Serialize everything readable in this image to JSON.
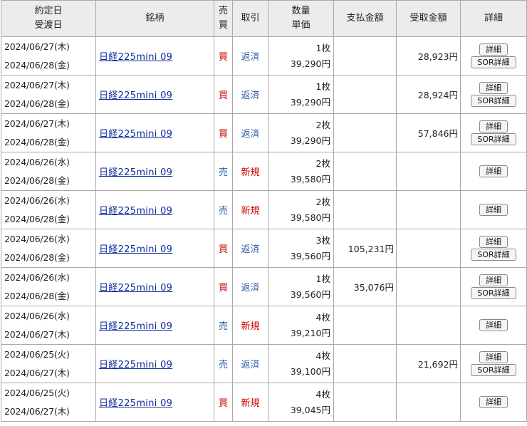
{
  "headers": {
    "date_top": "約定日",
    "date_bottom": "受渡日",
    "name": "銘柄",
    "side_top": "売",
    "side_bottom": "買",
    "trade": "取引",
    "qty_top": "数量",
    "qty_bottom": "単価",
    "pay": "支払金額",
    "receive": "受取金額",
    "detail": "詳細"
  },
  "rows": [
    {
      "trade_date": "2024/06/27(木)",
      "settle_date": "2024/06/28(金)",
      "name": "日経225mini 09",
      "side": "買",
      "trade": "返済",
      "qty": "1枚",
      "price": "39,290円",
      "pay": "",
      "receive": "28,923円",
      "detail": "詳細",
      "sor": "SOR詳細"
    },
    {
      "trade_date": "2024/06/27(木)",
      "settle_date": "2024/06/28(金)",
      "name": "日経225mini 09",
      "side": "買",
      "trade": "返済",
      "qty": "1枚",
      "price": "39,290円",
      "pay": "",
      "receive": "28,924円",
      "detail": "詳細",
      "sor": "SOR詳細"
    },
    {
      "trade_date": "2024/06/27(木)",
      "settle_date": "2024/06/28(金)",
      "name": "日経225mini 09",
      "side": "買",
      "trade": "返済",
      "qty": "2枚",
      "price": "39,290円",
      "pay": "",
      "receive": "57,846円",
      "detail": "詳細",
      "sor": "SOR詳細"
    },
    {
      "trade_date": "2024/06/26(水)",
      "settle_date": "2024/06/28(金)",
      "name": "日経225mini 09",
      "side": "売",
      "trade": "新規",
      "qty": "2枚",
      "price": "39,580円",
      "pay": "",
      "receive": "",
      "detail": "詳細",
      "sor": ""
    },
    {
      "trade_date": "2024/06/26(水)",
      "settle_date": "2024/06/28(金)",
      "name": "日経225mini 09",
      "side": "売",
      "trade": "新規",
      "qty": "2枚",
      "price": "39,580円",
      "pay": "",
      "receive": "",
      "detail": "詳細",
      "sor": ""
    },
    {
      "trade_date": "2024/06/26(水)",
      "settle_date": "2024/06/28(金)",
      "name": "日経225mini 09",
      "side": "買",
      "trade": "返済",
      "qty": "3枚",
      "price": "39,560円",
      "pay": "105,231円",
      "receive": "",
      "detail": "詳細",
      "sor": "SOR詳細"
    },
    {
      "trade_date": "2024/06/26(水)",
      "settle_date": "2024/06/28(金)",
      "name": "日経225mini 09",
      "side": "買",
      "trade": "返済",
      "qty": "1枚",
      "price": "39,560円",
      "pay": "35,076円",
      "receive": "",
      "detail": "詳細",
      "sor": "SOR詳細"
    },
    {
      "trade_date": "2024/06/26(水)",
      "settle_date": "2024/06/27(木)",
      "name": "日経225mini 09",
      "side": "売",
      "trade": "新規",
      "qty": "4枚",
      "price": "39,210円",
      "pay": "",
      "receive": "",
      "detail": "詳細",
      "sor": ""
    },
    {
      "trade_date": "2024/06/25(火)",
      "settle_date": "2024/06/27(木)",
      "name": "日経225mini 09",
      "side": "売",
      "trade": "返済",
      "qty": "4枚",
      "price": "39,100円",
      "pay": "",
      "receive": "21,692円",
      "detail": "詳細",
      "sor": "SOR詳細"
    },
    {
      "trade_date": "2024/06/25(火)",
      "settle_date": "2024/06/27(木)",
      "name": "日経225mini 09",
      "side": "買",
      "trade": "新規",
      "qty": "4枚",
      "price": "39,045円",
      "pay": "",
      "receive": "",
      "detail": "詳細",
      "sor": ""
    }
  ]
}
